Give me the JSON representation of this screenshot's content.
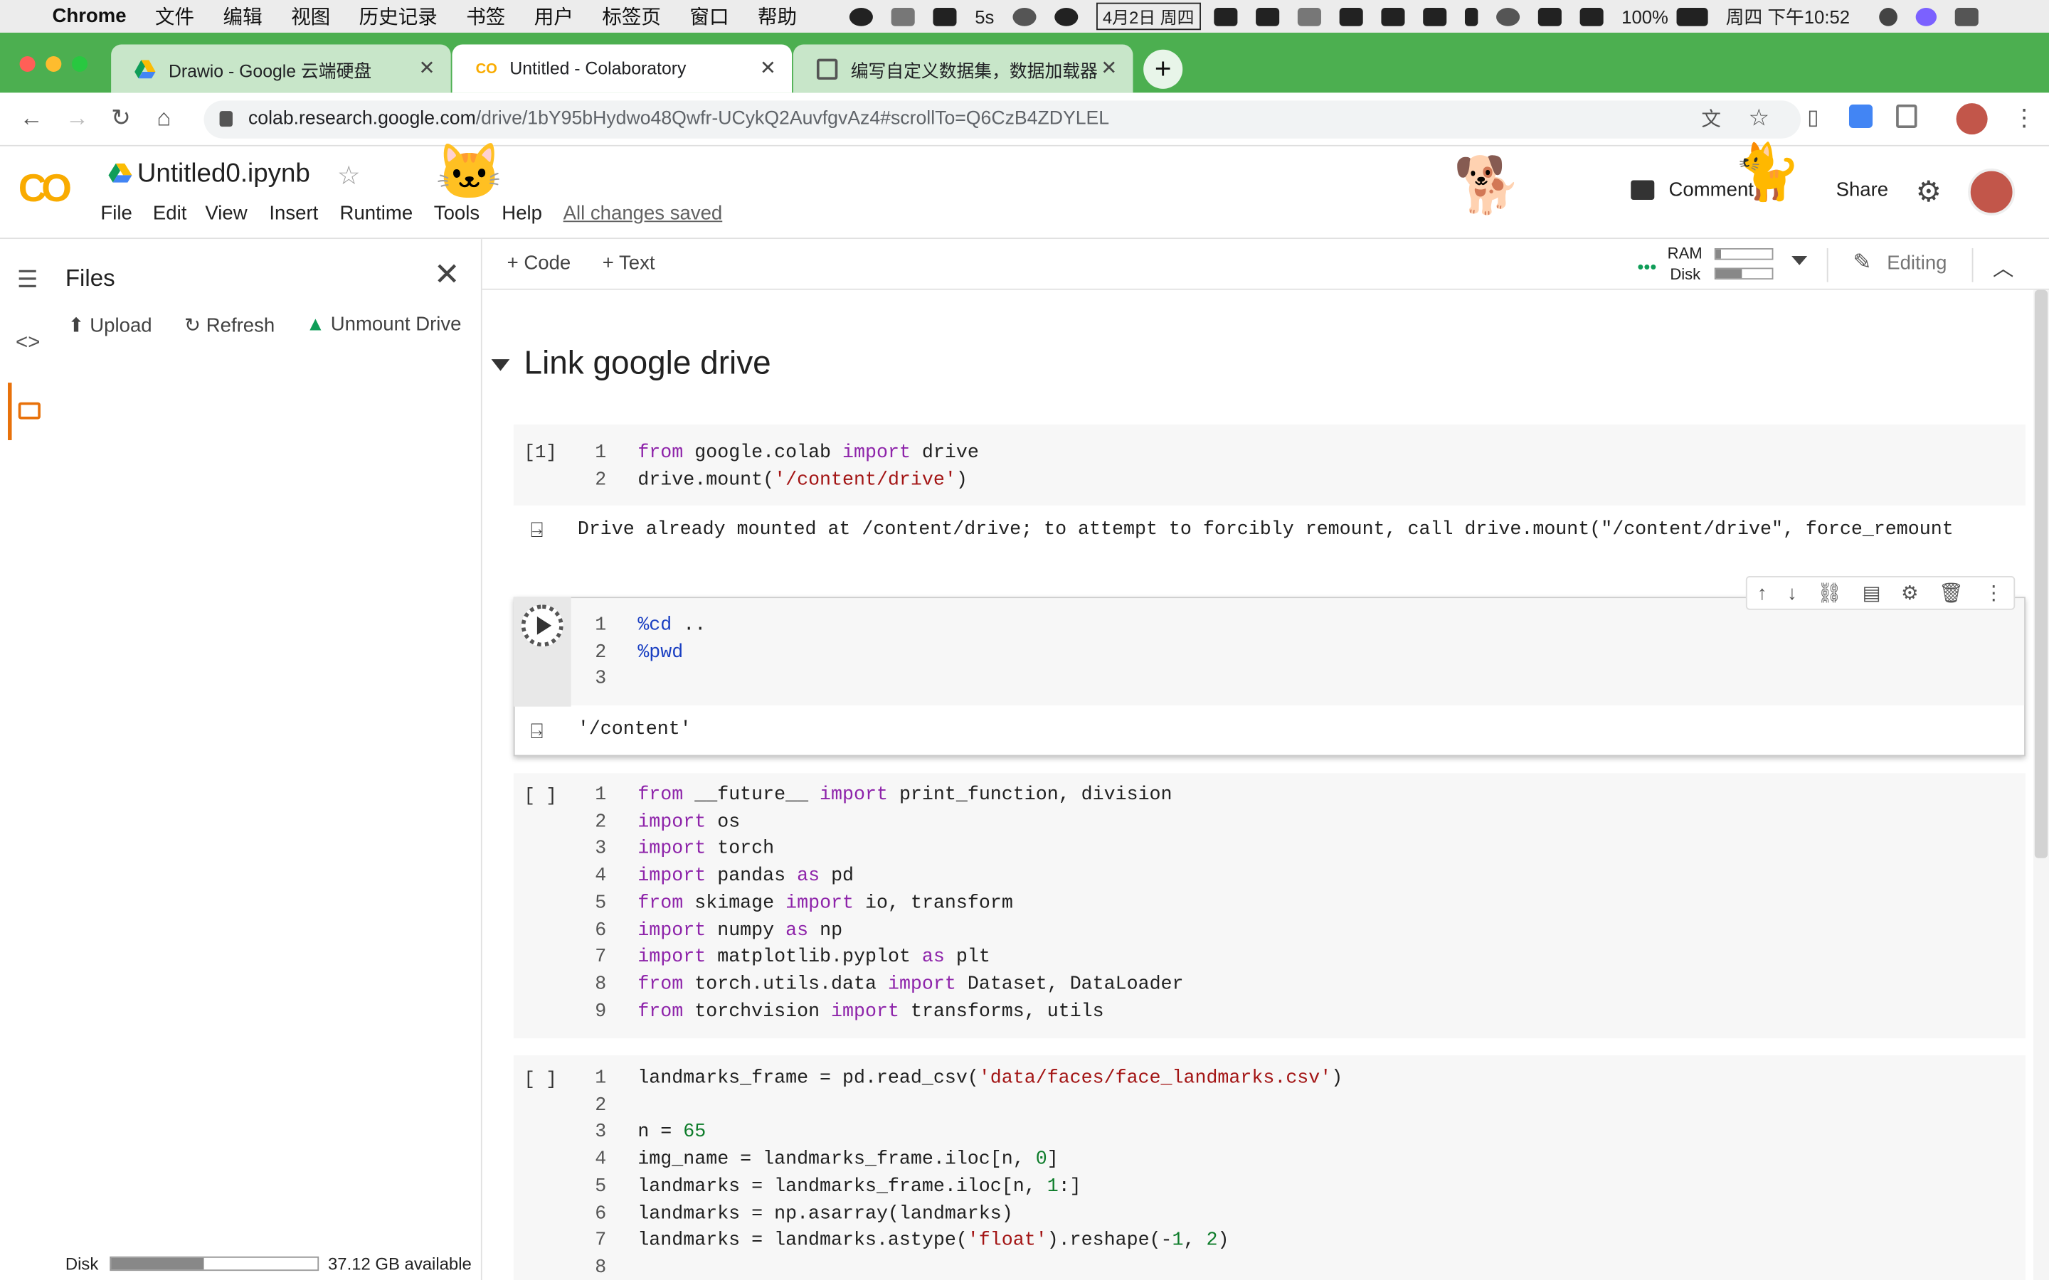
{
  "mac_menubar": {
    "apple": "",
    "app": "Chrome",
    "menus": [
      "文件",
      "编辑",
      "视图",
      "历史记录",
      "书签",
      "用户",
      "标签页",
      "窗口",
      "帮助"
    ],
    "status": {
      "timer": "5s",
      "date": "4月2日 周四",
      "battery": "100%",
      "clock": "周四 下午10:52"
    }
  },
  "tabs": [
    {
      "title": "Drawio - Google 云端硬盘"
    },
    {
      "title": "Untitled - Colaboratory"
    },
    {
      "title": "编写自定义数据集，数据加载器"
    }
  ],
  "address": {
    "host": "colab.research.google.com",
    "path": "/drive/1bY95bHydwo48Qwfr-UCykQ2AuvfgvAz4#scrollTo=Q6CzB4ZDYLEL"
  },
  "colab": {
    "logo": "CO",
    "notebook_title": "Untitled0.ipynb",
    "menus": [
      "File",
      "Edit",
      "View",
      "Insert",
      "Runtime",
      "Tools",
      "Help"
    ],
    "saved": "All changes saved",
    "comment": "Comment",
    "share": "Share"
  },
  "sidebar": {
    "title": "Files",
    "upload": "Upload",
    "refresh": "Refresh",
    "unmount": "Unmount Drive",
    "disk_label": "Disk",
    "disk_available": "37.12 GB available",
    "disk_used_fraction": 0.45
  },
  "toolbar": {
    "code": "+ Code",
    "text": "+ Text",
    "ram": "RAM",
    "disk": "Disk",
    "editing": "Editing"
  },
  "section_title": "Link google drive",
  "cells": [
    {
      "prompt": "[1]",
      "output": "Drive already mounted at /content/drive; to attempt to forcibly remount, call drive.mount(\"/content/drive\", force_remount"
    },
    {
      "prompt": "",
      "output": "'/content'"
    },
    {
      "prompt": "[ ]"
    },
    {
      "prompt": "[ ]"
    }
  ],
  "colors": {
    "chrome_tab_strip": "#4caf50",
    "colab_orange": "#f9ab00",
    "keyword": "#8e24aa",
    "string": "#a31515"
  }
}
